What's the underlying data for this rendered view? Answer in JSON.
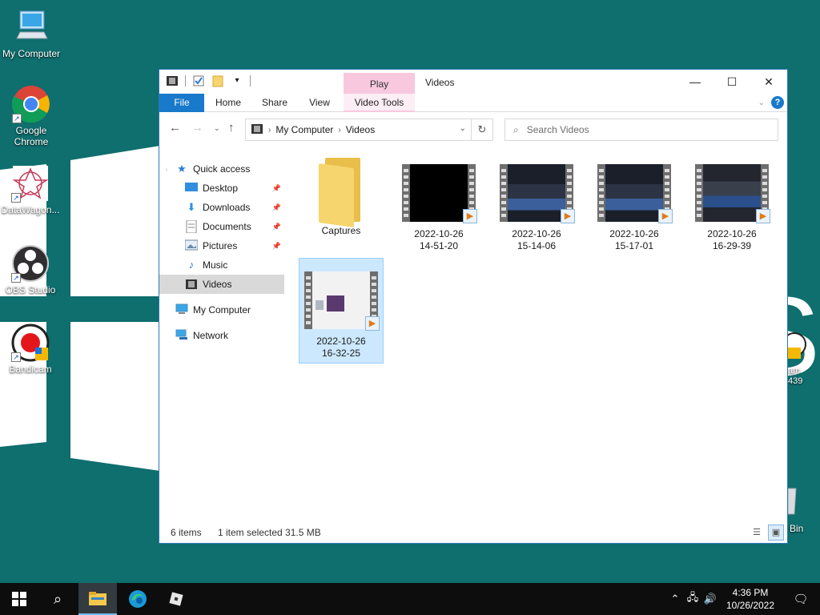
{
  "desktop": {
    "icons": [
      {
        "label": "My Computer",
        "icon": "computer-icon"
      },
      {
        "label": "Google Chrome",
        "icon": "chrome-icon"
      },
      {
        "label": "DataWagon...",
        "icon": "datawagon-icon"
      },
      {
        "label": "OBS Studio",
        "icon": "obs-icon"
      },
      {
        "label": "Bandicam",
        "icon": "bandicam-icon"
      }
    ],
    "right_partial": {
      "line1": "am",
      "line2": "439",
      "bin": "Bin"
    }
  },
  "window": {
    "title": "Videos",
    "context_tab": "Play",
    "controls": {
      "minimize": "—",
      "maximize": "☐",
      "close": "✕"
    },
    "ribbon_tabs": [
      "File",
      "Home",
      "Share",
      "View",
      "Video Tools"
    ],
    "breadcrumb": [
      "My Computer",
      "Videos"
    ],
    "search_placeholder": "Search Videos",
    "nav_pane": {
      "quick_access": "Quick access",
      "items": [
        {
          "label": "Desktop",
          "icon": "desktop-folder-icon",
          "pinned": true
        },
        {
          "label": "Downloads",
          "icon": "downloads-icon",
          "pinned": true
        },
        {
          "label": "Documents",
          "icon": "documents-icon",
          "pinned": true
        },
        {
          "label": "Pictures",
          "icon": "pictures-icon",
          "pinned": true
        },
        {
          "label": "Music",
          "icon": "music-icon",
          "pinned": false
        },
        {
          "label": "Videos",
          "icon": "videos-icon",
          "pinned": false,
          "selected": true
        }
      ],
      "my_computer": "My Computer",
      "network": "Network"
    },
    "files": [
      {
        "name": "Captures",
        "type": "folder"
      },
      {
        "line1": "2022-10-26",
        "line2": "14-51-20",
        "type": "video",
        "thumb": "black"
      },
      {
        "line1": "2022-10-26",
        "line2": "15-14-06",
        "type": "video",
        "thumb": "roblox"
      },
      {
        "line1": "2022-10-26",
        "line2": "15-17-01",
        "type": "video",
        "thumb": "roblox"
      },
      {
        "line1": "2022-10-26",
        "line2": "16-29-39",
        "type": "video",
        "thumb": "studio"
      },
      {
        "line1": "2022-10-26",
        "line2": "16-32-25",
        "type": "video",
        "thumb": "browser",
        "selected": true
      }
    ],
    "status": {
      "count": "6 items",
      "selection": "1 item selected  31.5 MB"
    }
  },
  "taskbar": {
    "time": "4:36 PM",
    "date": "10/26/2022",
    "pinned": [
      "windows-start-icon",
      "search-icon",
      "file-explorer-icon",
      "edge-icon",
      "roblox-icon"
    ]
  },
  "colors": {
    "wallpaper": "#0f6e6e",
    "accent": "#1979ca",
    "context_pink": "#f8c8df",
    "selection": "#cce8ff"
  }
}
